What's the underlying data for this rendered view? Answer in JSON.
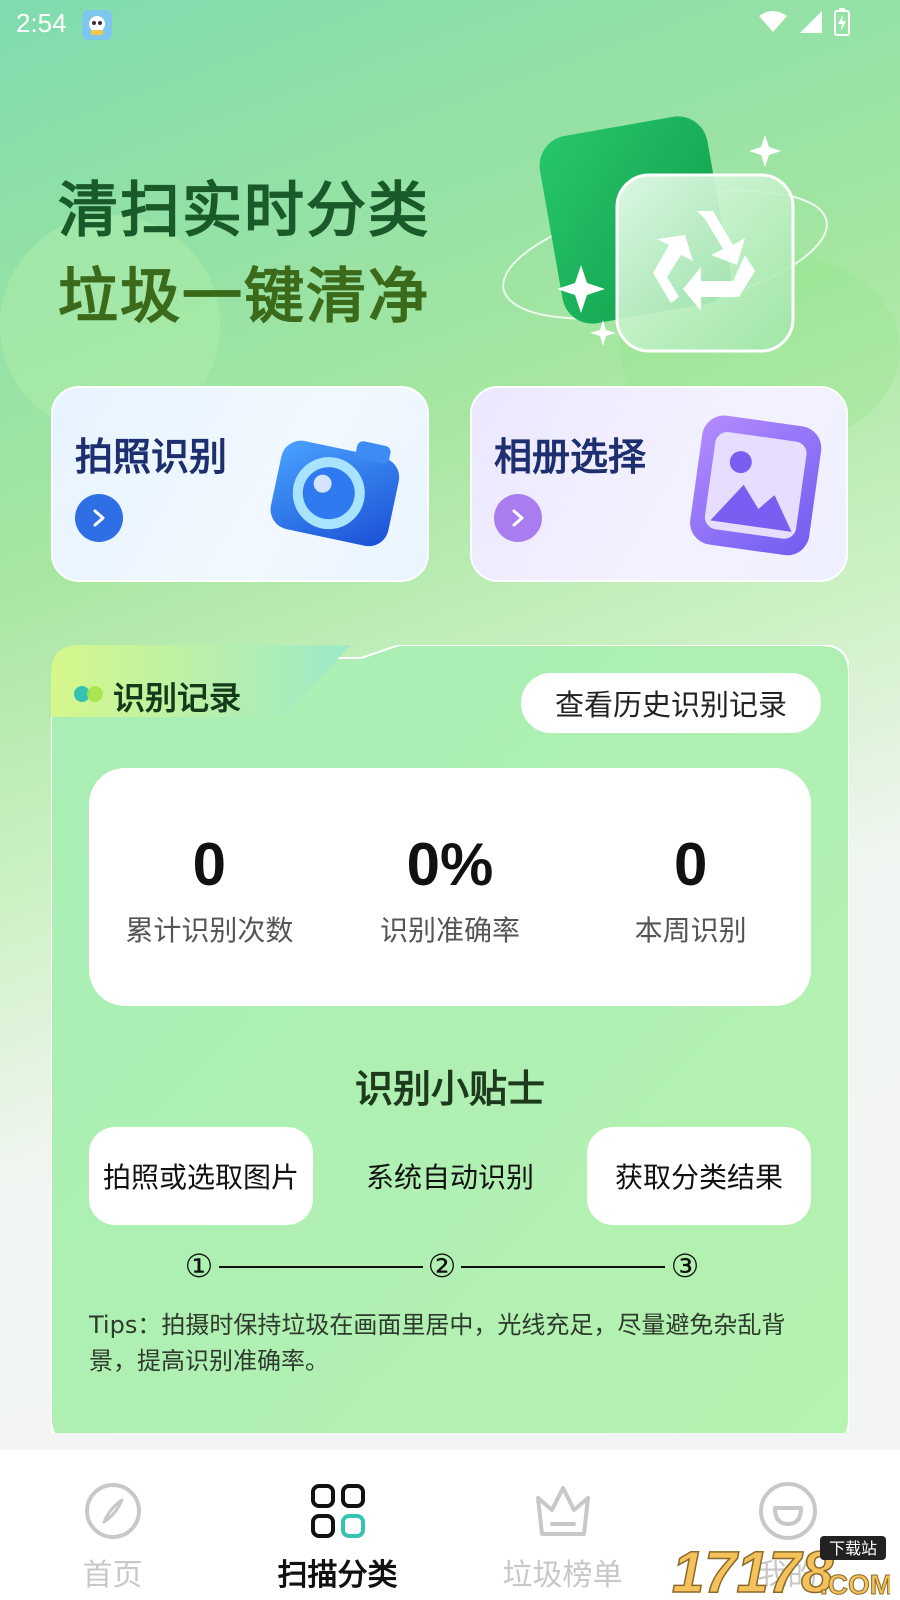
{
  "status_bar": {
    "time": "2:54",
    "icons": [
      "app-notification-icon",
      "wifi-icon",
      "signal-icon",
      "battery-charging-icon"
    ]
  },
  "hero": {
    "line1": "清扫实时分类",
    "line2": "垃圾一键清净",
    "illustration": "recycle-icon"
  },
  "actions": [
    {
      "label": "拍照识别",
      "icon": "camera-icon",
      "accent": "#2f6fe5"
    },
    {
      "label": "相册选择",
      "icon": "album-icon",
      "accent": "#a97cf0"
    }
  ],
  "record": {
    "title": "识别记录",
    "history_button": "查看历史识别记录",
    "stats": [
      {
        "value": "0",
        "label": "累计识别次数"
      },
      {
        "value": "0%",
        "label": "识别准确率"
      },
      {
        "value": "0",
        "label": "本周识别"
      }
    ],
    "tips_title": "识别小贴士",
    "steps": [
      "拍照或选取图片",
      "系统自动识别",
      "获取分类结果"
    ],
    "step_numbers": [
      "①",
      "②",
      "③"
    ],
    "tips_text": "Tips：拍摄时保持垃圾在画面里居中，光线充足，尽量避免杂乱背景，提高识别准确率。"
  },
  "nav": {
    "items": [
      {
        "label": "首页",
        "icon": "compass-icon",
        "active": false
      },
      {
        "label": "扫描分类",
        "icon": "grid-icon",
        "active": true
      },
      {
        "label": "垃圾榜单",
        "icon": "crown-icon",
        "active": false
      },
      {
        "label": "我的",
        "icon": "smile-icon",
        "active": false
      }
    ]
  },
  "watermark": {
    "text": "17178",
    "sub": "下载站",
    "suffix": ".COM"
  },
  "colors": {
    "primary_green": "#1a5a2a",
    "accent_teal": "#34c3b0",
    "nav_inactive": "#c8c8c8"
  }
}
